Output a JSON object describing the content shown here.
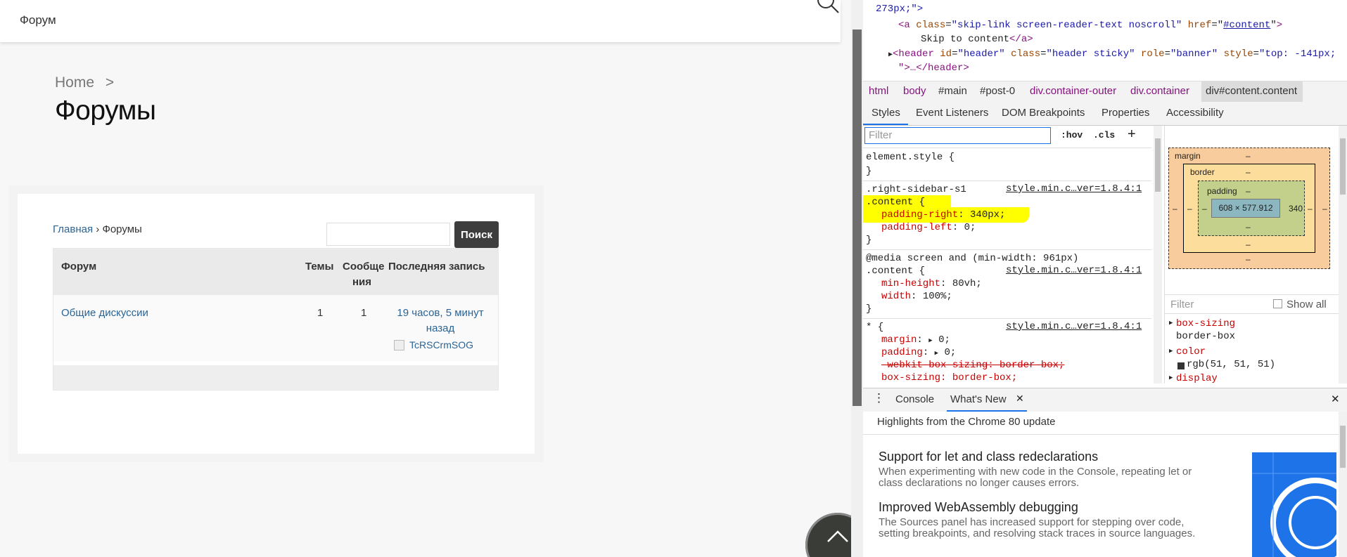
{
  "site": {
    "nav_label": "Форум",
    "breadcrumb_home": "Home",
    "breadcrumb_sep": ">",
    "page_title": "Форумы"
  },
  "forum": {
    "crumb_home": "Главная",
    "crumb_sep": "›",
    "crumb_current": "Форумы",
    "search_button": "Поиск",
    "search_value": "",
    "columns": {
      "forum": "Форум",
      "topics": "Темы",
      "posts_line1": "Сообще",
      "posts_line2": "ния",
      "last_post": "Последняя запись"
    },
    "rows": [
      {
        "name": "Общие дискуссии",
        "topics": "1",
        "posts": "1",
        "last_line1": "19 часов, 5 минут",
        "last_line2": "назад",
        "author": "TcRSCrmSOG"
      }
    ]
  },
  "devtools": {
    "dom": {
      "line0": "273px;\">",
      "line1_tag": "<a",
      "line1_attr1": "class",
      "line1_val1": "\"skip-link screen-reader-text noscroll\"",
      "line1_attr2": "href",
      "line1_val2": "#content",
      "line2_text": "Skip to content",
      "line2_close": "</a>",
      "line3_tag": "<header",
      "line3_id_val": "\"header\"",
      "line3_class_val": "\"header sticky\"",
      "line3_role_val": "\"banner\"",
      "line3_style_val": "\"top: -141px;",
      "line4": "\">…</header>"
    },
    "breadcrumbs": [
      "html",
      "body",
      "#main",
      "#post-0",
      "div.container-outer",
      "div.container",
      "div#content.content"
    ],
    "tabs": [
      "Styles",
      "Event Listeners",
      "DOM Breakpoints",
      "Properties",
      "Accessibility"
    ],
    "filter_placeholder": "Filter",
    "hov_label": ":hov",
    "cls_label": ".cls",
    "plus_label": "+",
    "rules": {
      "element_style": "element.style {",
      "close_brace": "}",
      "r1_selector1": ".right-sidebar-s1",
      "r1_selector2": ".content {",
      "r1_source": "style.min.c…ver=1.8.4:1",
      "r1_p1_name": "padding-right",
      "r1_p1_val": "340px;",
      "r1_p2_name": "padding-left",
      "r1_p2_val": "0;",
      "r2_media": "@media screen and (min-width: 961px)",
      "r2_selector": ".content {",
      "r2_source": "style.min.c…ver=1.8.4:1",
      "r2_p1_name": "min-height",
      "r2_p1_val": "80vh;",
      "r2_p2_name": "width",
      "r2_p2_val": "100%;",
      "r3_selector": "* {",
      "r3_source": "style.min.c…ver=1.8.4:1",
      "r3_p1_name": "margin",
      "r3_p1_val": "0;",
      "r3_p2_name": "padding",
      "r3_p2_val": "0;",
      "r3_p3": "-webkit-box-sizing: border-box;",
      "r3_p4": "box-sizing: border-box;"
    },
    "boxmodel": {
      "margin_label": "margin",
      "border_label": "border",
      "padding_label": "padding",
      "dash": "–",
      "content": "608 × 577.912",
      "padding_right": "340"
    },
    "computed": {
      "filter_placeholder": "Filter",
      "show_all": "Show all",
      "p1_name": "box-sizing",
      "p1_val": "border-box",
      "p2_name": "color",
      "p2_val": "rgb(51, 51, 51)",
      "p3_name": "display"
    },
    "drawer": {
      "menu": "⋮",
      "tab1": "Console",
      "tab2": "What's New",
      "close_tab": "✕",
      "close_drawer": "✕",
      "subtitle": "Highlights from the Chrome 80 update",
      "item1_title": "Support for let and class redeclarations",
      "item1_desc": "When experimenting with new code in the Console, repeating let or class declarations no longer causes errors.",
      "item2_title": "Improved WebAssembly debugging",
      "item2_desc": "The Sources panel has increased support for stepping over code, setting breakpoints, and resolving stack traces in source languages."
    }
  },
  "colors": {
    "link": "#2a6496",
    "highlight": "#ffff00",
    "devtools_accent": "#1a73e8"
  }
}
